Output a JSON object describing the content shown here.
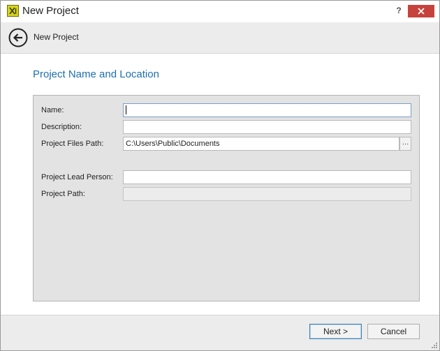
{
  "window": {
    "title": "New Project",
    "icon": "xl-app-icon",
    "help_label": "?",
    "close_icon": "close-icon"
  },
  "nav": {
    "back_icon": "arrow-left-circle-icon",
    "title": "New Project"
  },
  "section": {
    "title": "Project Name and Location"
  },
  "form": {
    "name": {
      "label": "Name:",
      "value": ""
    },
    "description": {
      "label": "Description:",
      "value": ""
    },
    "files_path": {
      "label": "Project Files Path:",
      "value": "C:\\Users\\Public\\Documents",
      "browse_label": "…"
    },
    "lead_person": {
      "label": "Project Lead Person:",
      "value": ""
    },
    "project_path": {
      "label": "Project Path:",
      "value": ""
    }
  },
  "footer": {
    "next_label": "Next >",
    "cancel_label": "Cancel"
  },
  "colors": {
    "accent_title": "#1e6fb0",
    "close_button": "#c7423c",
    "panel_bg": "#e3e3e3"
  }
}
